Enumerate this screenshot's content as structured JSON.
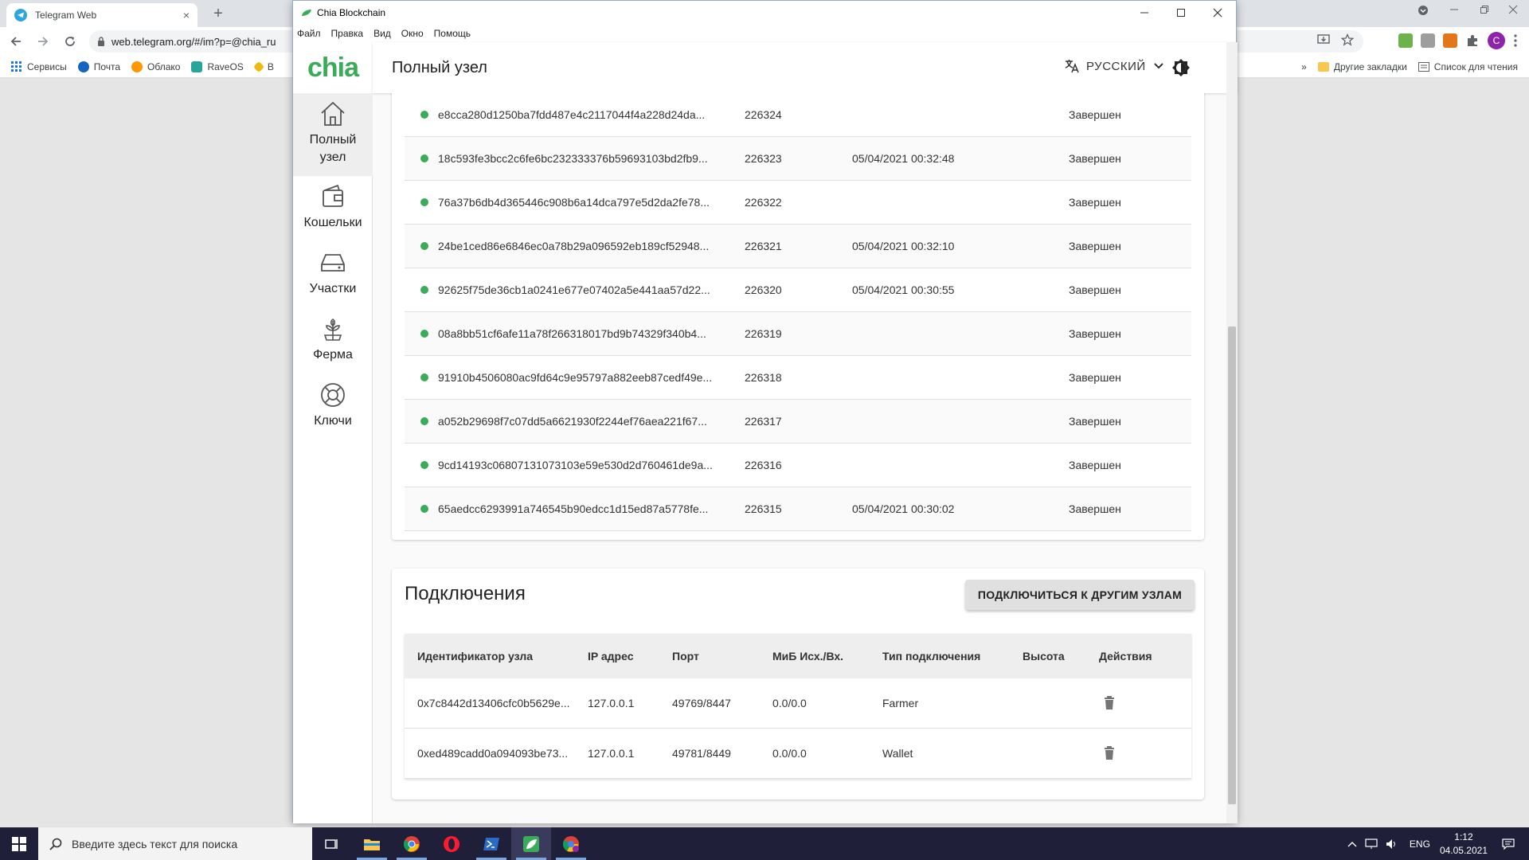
{
  "browser": {
    "tab_title": "Telegram Web",
    "tab_close": "×",
    "new_tab": "+",
    "url": "web.telegram.org/#/im?p=@chia_ru",
    "bookmarks": [
      "Сервисы",
      "Почта",
      "Облако",
      "RaveOS",
      "B"
    ],
    "bookmarks_more": "»",
    "other_bookmarks": "Другие закладки",
    "reading_list": "Список для чтения",
    "profile_initial": "C"
  },
  "app": {
    "window_title": "Chia Blockchain",
    "menu": [
      "Файл",
      "Правка",
      "Вид",
      "Окно",
      "Помощь"
    ],
    "logo": "chia",
    "page_title": "Полный узел",
    "language": "РУССКИЙ",
    "nav": [
      {
        "label": "Полный узел",
        "icon": "home-icon"
      },
      {
        "label": "Кошельки",
        "icon": "wallet-icon"
      },
      {
        "label": "Участки",
        "icon": "hard-drive-icon"
      },
      {
        "label": "Ферма",
        "icon": "plant-icon"
      },
      {
        "label": "Ключи",
        "icon": "lifebuoy-icon"
      }
    ]
  },
  "blocks": [
    {
      "hash": "e8cca280d1250ba7fdd487e4c2117044f4a228d24da...",
      "height": "226324",
      "time": "",
      "state": "Завершен"
    },
    {
      "hash": "18c593fe3bcc2c6fe6bc232333376b59693103bd2fb9...",
      "height": "226323",
      "time": "05/04/2021 00:32:48",
      "state": "Завершен"
    },
    {
      "hash": "76a37b6db4d365446c908b6a14dca797e5d2da2fe78...",
      "height": "226322",
      "time": "",
      "state": "Завершен"
    },
    {
      "hash": "24be1ced86e6846ec0a78b29a096592eb189cf52948...",
      "height": "226321",
      "time": "05/04/2021 00:32:10",
      "state": "Завершен"
    },
    {
      "hash": "92625f75de36cb1a0241e677e07402a5e441aa57d22...",
      "height": "226320",
      "time": "05/04/2021 00:30:55",
      "state": "Завершен"
    },
    {
      "hash": "08a8bb51cf6afe11a78f266318017bd9b74329f340b4...",
      "height": "226319",
      "time": "",
      "state": "Завершен"
    },
    {
      "hash": "91910b4506080ac9fd64c9e95797a882eeb87cedf49e...",
      "height": "226318",
      "time": "",
      "state": "Завершен"
    },
    {
      "hash": "a052b29698f7c07dd5a6621930f2244ef76aea221f67...",
      "height": "226317",
      "time": "",
      "state": "Завершен"
    },
    {
      "hash": "9cd14193c06807131073103e59e530d2d760461de9a...",
      "height": "226316",
      "time": "",
      "state": "Завершен"
    },
    {
      "hash": "65aedcc6293991a746545b90edcc1d15ed87a5778fe...",
      "height": "226315",
      "time": "05/04/2021 00:30:02",
      "state": "Завершен"
    }
  ],
  "connections": {
    "title": "Подключения",
    "connect_button": "ПОДКЛЮЧИТЬСЯ К ДРУГИМ УЗЛАМ",
    "headers": [
      "Идентификатор узла",
      "IP адрес",
      "Порт",
      "МиБ Исх./Вх.",
      "Тип подключения",
      "Высота",
      "Действия"
    ],
    "rows": [
      {
        "node_id": "0x7c8442d13406cfc0b5629e...",
        "ip": "127.0.0.1",
        "port": "49769/8447",
        "mib": "0.0/0.0",
        "type": "Farmer",
        "height": ""
      },
      {
        "node_id": "0xed489cadd0a094093be73...",
        "ip": "127.0.0.1",
        "port": "49781/8449",
        "mib": "0.0/0.0",
        "type": "Wallet",
        "height": ""
      }
    ]
  },
  "taskbar": {
    "search_placeholder": "Введите здесь текст для поиска",
    "lang": "ENG",
    "time": "1:12",
    "date": "04.05.2021"
  },
  "colors": {
    "accent": "#3aac59",
    "taskbar": "#1f1f3a"
  }
}
